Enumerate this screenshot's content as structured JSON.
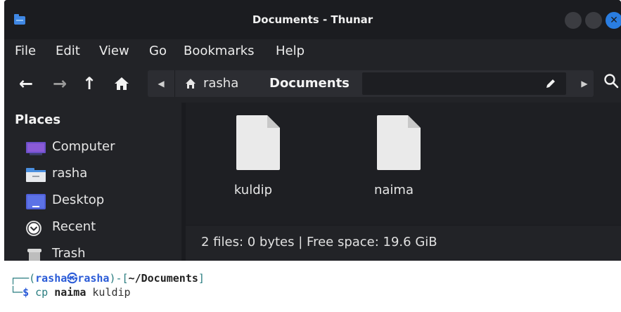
{
  "window": {
    "title": "Documents - Thunar",
    "close_glyph": "✕"
  },
  "menu": [
    "File",
    "Edit",
    "View",
    "Go",
    "Bookmarks",
    "Help"
  ],
  "toolbar": {
    "back_glyph": "←",
    "forward_glyph": "→",
    "up_glyph": "↑",
    "path_left_glyph": "◀",
    "path_right_glyph": "▶"
  },
  "pathbar": {
    "home_crumb": "rasha",
    "current_crumb": "Documents"
  },
  "sidebar": {
    "heading": "Places",
    "items": [
      {
        "label": "Computer",
        "icon": "computer-icon"
      },
      {
        "label": "rasha",
        "icon": "home-folder-icon"
      },
      {
        "label": "Desktop",
        "icon": "desktop-icon"
      },
      {
        "label": "Recent",
        "icon": "recent-icon"
      },
      {
        "label": "Trash",
        "icon": "trash-icon"
      }
    ]
  },
  "files": [
    {
      "name": "kuldip",
      "icon": "document-icon"
    },
    {
      "name": "naima",
      "icon": "document-icon"
    }
  ],
  "status": {
    "text": "2 files: 0 bytes | Free space: 19.6 GiB"
  },
  "terminal": {
    "prompt_open": "┌──(",
    "user": "rasha",
    "at_glyph": "㉿",
    "host": "rasha",
    "prompt_mid": ")-[",
    "cwd": "~/Documents",
    "prompt_close": "]",
    "line2_prefix": "└─",
    "dollar": "$",
    "command": "cp",
    "arg1": "naima",
    "arg2": "kuldip"
  },
  "colors": {
    "accent": "#2a7de1",
    "window_bg": "#222327",
    "content_bg": "#1e1f23"
  }
}
